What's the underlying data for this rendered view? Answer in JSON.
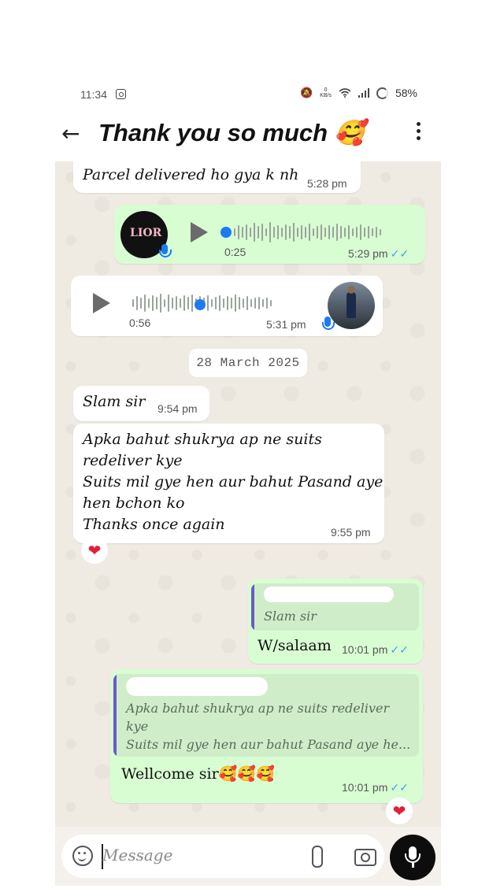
{
  "status_bar": {
    "time": "11:34",
    "speed_value": "0",
    "speed_unit": "KB/s",
    "battery": "58%"
  },
  "header": {
    "title": "Thank you so much 🥰"
  },
  "messages": {
    "m1": {
      "text": "Parcel delivered ho gya k nh",
      "time": "5:28 pm"
    },
    "voice_out": {
      "avatar_text": "LIOR",
      "duration": "0:25",
      "time": "5:29 pm",
      "ticks": "✓✓"
    },
    "voice_in": {
      "duration": "0:56",
      "time": "5:31 pm"
    },
    "date_separator": "28 March 2025",
    "m2": {
      "text": "Slam sir",
      "time": "9:54 pm"
    },
    "m3": {
      "lines": [
        "Apka bahut shukrya ap ne suits",
        "redeliver kye",
        "Suits mil gye hen aur bahut Pasand aye",
        "hen bchon ko",
        "Thanks once again"
      ],
      "time": "9:55 pm",
      "reaction": "❤"
    },
    "reply1": {
      "quoted": "Slam sir",
      "text": "W/salaam",
      "time": "10:01 pm",
      "ticks": "✓✓"
    },
    "reply2": {
      "quoted_lines": [
        "Apka bahut shukrya ap ne suits redeliver",
        "kye",
        "Suits mil gye hen aur bahut Pasand aye he..."
      ],
      "text": "Wellcome sir🥰🥰🥰",
      "time": "10:01 pm",
      "ticks": "✓✓",
      "reaction": "❤"
    }
  },
  "input": {
    "placeholder": "Message"
  },
  "colors": {
    "outgoing_bubble": "#d8fdd2",
    "incoming_bubble": "#ffffff",
    "chat_background": "#efeae2",
    "read_ticks": "#3ea7e0",
    "voice_progress": "#1c7bf0",
    "quote_bar": "#6b5ac8"
  }
}
